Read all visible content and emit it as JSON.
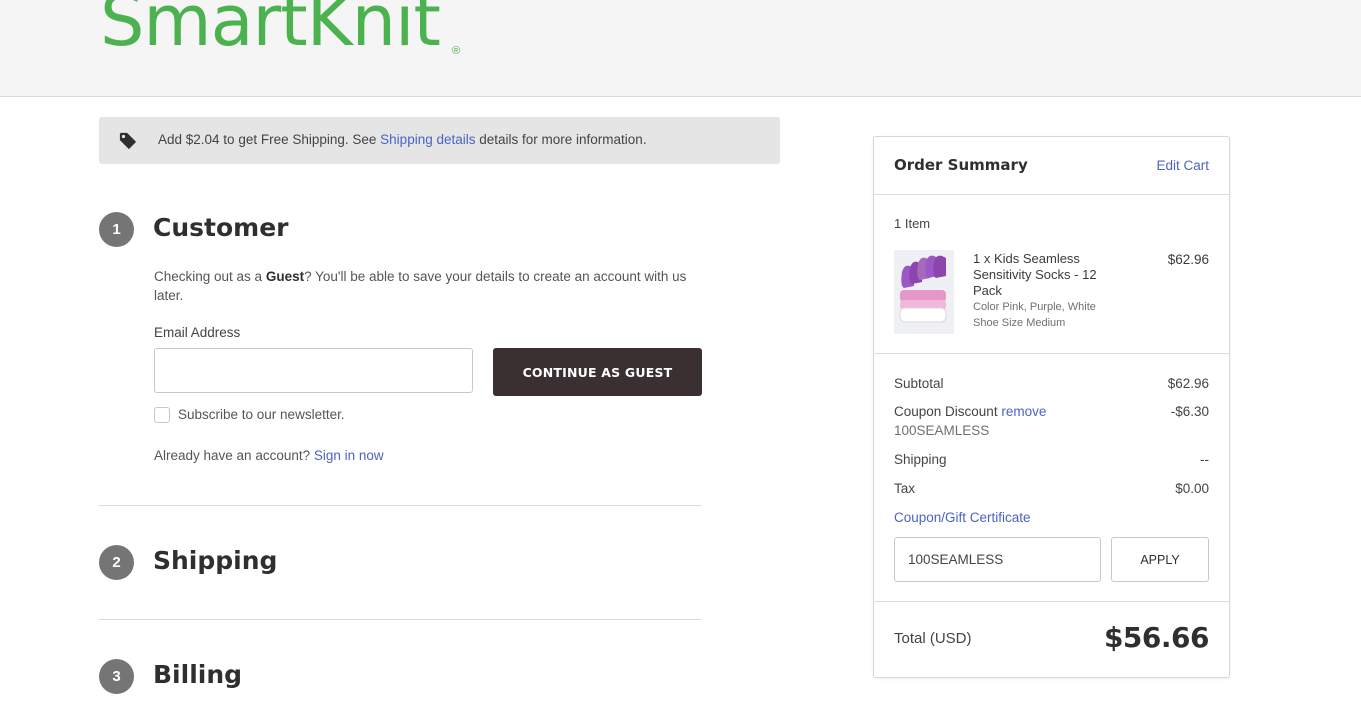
{
  "brand": {
    "logo_text": "SmartKnit",
    "reg_mark": "®",
    "color": "#4cb24f"
  },
  "banner": {
    "icon": "tag-icon",
    "prefix": "Add  $2.04 to get Free Shipping. See ",
    "link": "Shipping details",
    "suffix": " details for more information."
  },
  "steps": [
    {
      "number": "1",
      "title": "Customer"
    },
    {
      "number": "2",
      "title": "Shipping"
    },
    {
      "number": "3",
      "title": "Billing"
    }
  ],
  "customer": {
    "guest_prefix": "Checking out as a ",
    "guest_bold": "Guest",
    "guest_suffix": "? You'll be able to save your details to create an account with us later.",
    "email_label": "Email Address",
    "email_value": "",
    "continue_label": "CONTINUE AS GUEST",
    "newsletter_label": "Subscribe to our newsletter.",
    "newsletter_checked": false,
    "signin_prefix": "Already have an account? ",
    "signin_link": "Sign in now"
  },
  "summary": {
    "title": "Order Summary",
    "edit_cart": "Edit Cart",
    "item_count": "1 Item",
    "product": {
      "name": "1 x Kids Seamless Sensitivity Socks - 12 Pack",
      "option_color": "Color Pink, Purple, White",
      "option_size": "Shoe Size Medium",
      "price": "$62.96"
    },
    "subtotal_label": "Subtotal",
    "subtotal_value": "$62.96",
    "coupon_label": "Coupon Discount ",
    "coupon_remove": "remove",
    "coupon_code": "100SEAMLESS",
    "coupon_value": "-$6.30",
    "shipping_label": "Shipping",
    "shipping_value": "--",
    "tax_label": "Tax",
    "tax_value": "$0.00",
    "coupon_gift_link": "Coupon/Gift Certificate",
    "coupon_input_value": "100SEAMLESS",
    "apply_label": "APPLY",
    "total_label": "Total (USD)",
    "total_value": "$56.66"
  },
  "colors": {
    "accent_link": "#4a63c5",
    "primary_button": "#3a2f31",
    "step_circle": "#757575",
    "banner_bg": "#e5e5e5"
  }
}
